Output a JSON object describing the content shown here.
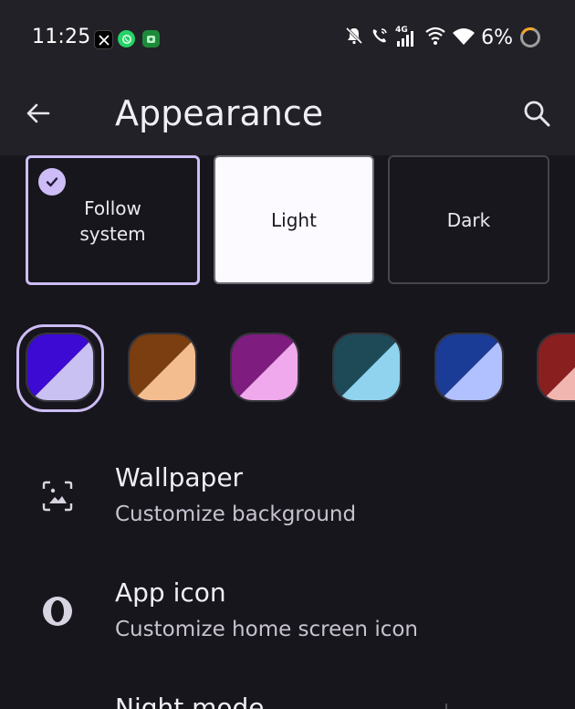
{
  "status_bar": {
    "time": "11:25",
    "apps": [
      "x-icon",
      "whatsapp-icon",
      "vpn-icon"
    ],
    "indicators": [
      "bell-off-icon",
      "wifi-call-icon",
      "signal-4g-icon",
      "wifi-hotspot-icon",
      "wifi-icon"
    ],
    "network_label": "4G",
    "battery": "6%"
  },
  "app_bar": {
    "title": "Appearance",
    "back_icon": "arrow-left-icon",
    "search_icon": "search-icon"
  },
  "theme_options": [
    {
      "label": "Follow system",
      "selected": true
    },
    {
      "label": "Light",
      "selected": false
    },
    {
      "label": "Dark",
      "selected": false
    }
  ],
  "color_swatches": [
    {
      "name": "violet",
      "primary": "#3c0ad3",
      "secondary": "#cac1f3",
      "selected": true
    },
    {
      "name": "brown",
      "primary": "#7a3e10",
      "secondary": "#f3bd90",
      "selected": false
    },
    {
      "name": "purple",
      "primary": "#7e1c80",
      "secondary": "#f0a9ed",
      "selected": false
    },
    {
      "name": "teal",
      "primary": "#1e4a58",
      "secondary": "#8fd3ee",
      "selected": false
    },
    {
      "name": "blue",
      "primary": "#1b3c96",
      "secondary": "#b1c1ff",
      "selected": false
    },
    {
      "name": "red",
      "primary": "#8a1f20",
      "secondary": "#f1b6b0",
      "selected": false
    }
  ],
  "settings": [
    {
      "title": "Wallpaper",
      "subtitle": "Customize background",
      "icon": "wallpaper-icon"
    },
    {
      "title": "App icon",
      "subtitle": "Customize home screen icon",
      "icon": "opera-icon"
    },
    {
      "title": "Night mode",
      "subtitle": "",
      "icon": ""
    }
  ],
  "colors": {
    "background": "#17161c",
    "app_bar": "#222127",
    "accent": "#cdbcf5"
  }
}
